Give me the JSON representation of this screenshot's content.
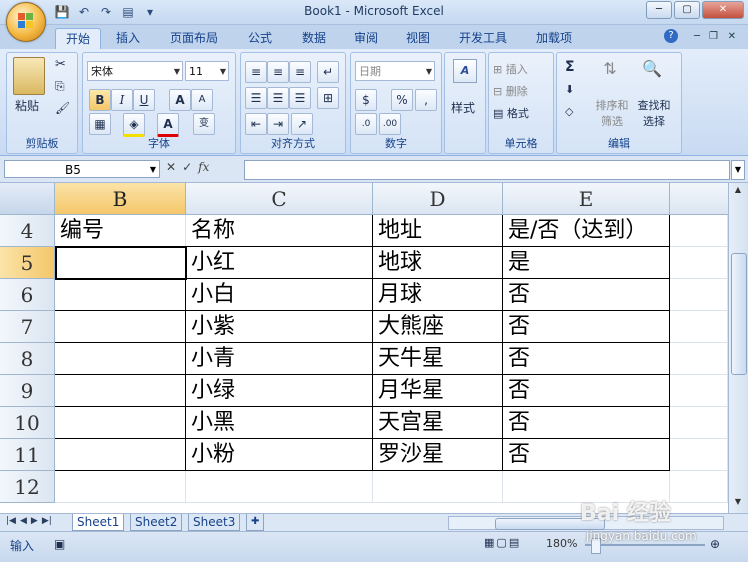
{
  "window": {
    "title": "Book1 - Microsoft Excel",
    "min": "─",
    "max": "▢",
    "close": "✕"
  },
  "ribbon_tabs": [
    "开始",
    "插入",
    "页面布局",
    "公式",
    "数据",
    "审阅",
    "视图",
    "开发工具",
    "加载项"
  ],
  "clipboard": {
    "paste": "粘贴",
    "label": "剪贴板"
  },
  "font": {
    "family": "宋体",
    "size": "11",
    "bold": "B",
    "italic": "I",
    "underline": "U",
    "grow": "A",
    "shrink": "A",
    "color": "A",
    "wen": "变",
    "label": "字体"
  },
  "alignment": {
    "label": "对齐方式"
  },
  "number": {
    "format": "日期",
    "percent": "%",
    "comma": ",",
    "label": "数字"
  },
  "styles": {
    "label": "样式"
  },
  "cells": {
    "insert": "插入",
    "delete": "删除",
    "format": "格式",
    "label": "单元格"
  },
  "editing": {
    "sigma": "Σ",
    "sort": "排序和\n筛选",
    "find": "查找和\n选择",
    "label": "编辑"
  },
  "formula_bar": {
    "namebox": "B5",
    "fx": "fx",
    "value": ""
  },
  "columns": [
    "B",
    "C",
    "D",
    "E"
  ],
  "rows": [
    {
      "num": "4",
      "cells": [
        "编号",
        "名称",
        "地址",
        "是/否（达到）"
      ]
    },
    {
      "num": "5",
      "cells": [
        "",
        "小红",
        "地球",
        "是"
      ]
    },
    {
      "num": "6",
      "cells": [
        "",
        "小白",
        "月球",
        "否"
      ]
    },
    {
      "num": "7",
      "cells": [
        "",
        "小紫",
        "大熊座",
        "否"
      ]
    },
    {
      "num": "8",
      "cells": [
        "",
        "小青",
        "天牛星",
        "否"
      ]
    },
    {
      "num": "9",
      "cells": [
        "",
        "小绿",
        "月华星",
        "否"
      ]
    },
    {
      "num": "10",
      "cells": [
        "",
        "小黑",
        "天宫星",
        "否"
      ]
    },
    {
      "num": "11",
      "cells": [
        "",
        "小粉",
        "罗沙星",
        "否"
      ]
    },
    {
      "num": "12",
      "cells": [
        "",
        "",
        "",
        ""
      ]
    }
  ],
  "sheets": [
    "Sheet1",
    "Sheet2",
    "Sheet3"
  ],
  "status": {
    "mode": "输入",
    "zoom": "180%"
  },
  "watermark": {
    "brand": "Bai 经验",
    "url": "jingyan.baidu.com"
  }
}
